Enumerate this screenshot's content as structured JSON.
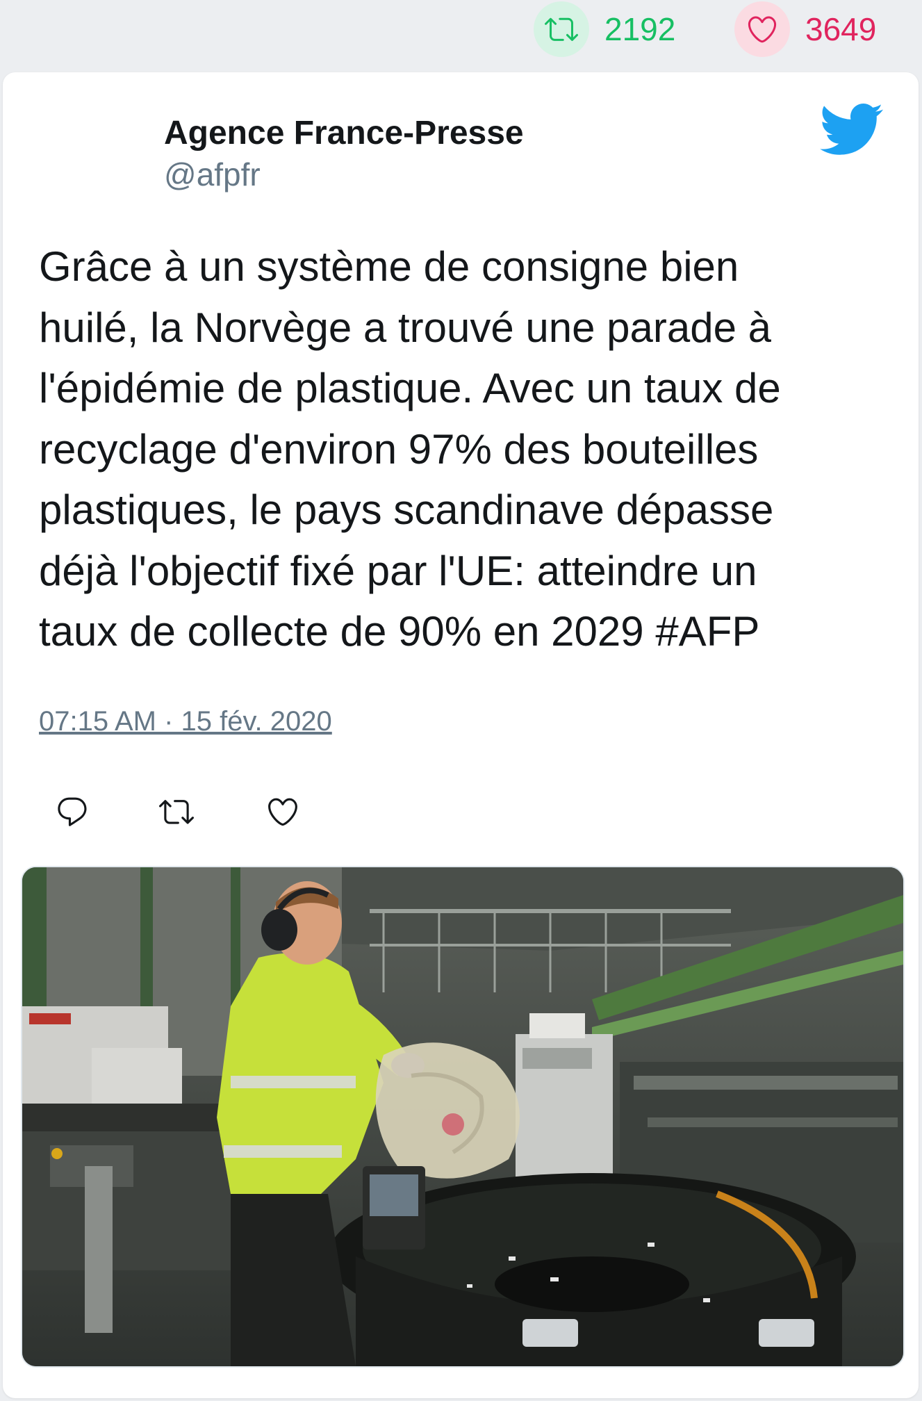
{
  "stats": {
    "retweet_count": "2192",
    "like_count": "3649",
    "retweet_color": "#17bf63",
    "like_color": "#e0245e"
  },
  "tweet": {
    "author_name": "Agence France-Presse",
    "author_handle": "@afpfr",
    "text_lines": [
      "Grâce à un système de consigne bien",
      "huilé, la Norvège a trouvé une parade à",
      "l'épidémie de plastique. Avec un taux de",
      "recyclage d'environ 97% des bouteilles",
      "plastiques, le pays scandinave dépasse",
      "déjà l'objectif fixé par l'UE: atteindre un",
      "taux de collecte de 90% en 2029 #AFP"
    ],
    "timestamp": "07:15 AM · 15 fév. 2020"
  },
  "icons": {
    "retweet": "retweet-icon",
    "like": "heart-icon",
    "reply": "reply-icon",
    "brand": "twitter-bird-icon"
  },
  "media": {
    "kind": "photo",
    "subject": "worker-emptying-plastic-bag-into-sorting-machine"
  }
}
